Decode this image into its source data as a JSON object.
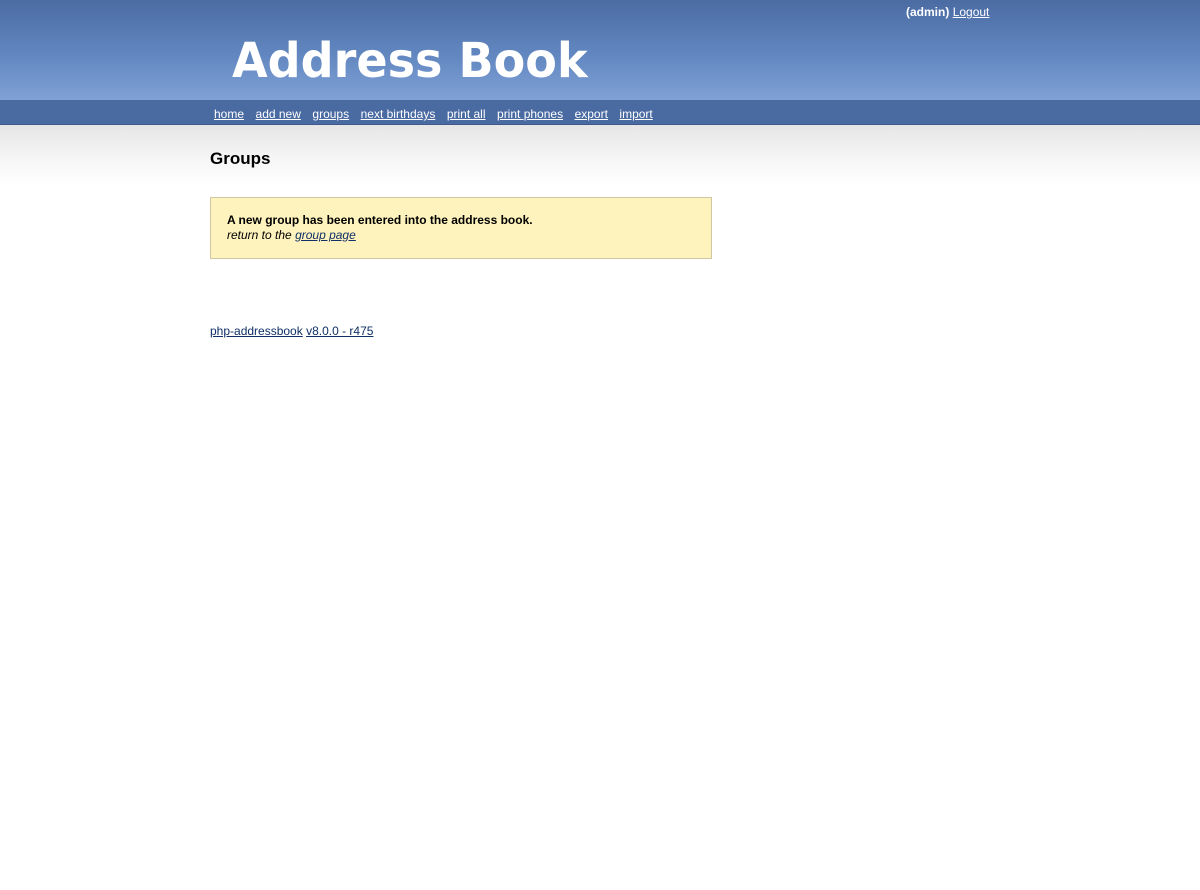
{
  "header": {
    "user_label": "(admin)",
    "logout_label": "Logout",
    "logo_text": "Address Book"
  },
  "nav": {
    "items": [
      {
        "label": "home"
      },
      {
        "label": "add new"
      },
      {
        "label": "groups"
      },
      {
        "label": "next birthdays"
      },
      {
        "label": "print all"
      },
      {
        "label": "print phones"
      },
      {
        "label": "export"
      },
      {
        "label": "import"
      }
    ]
  },
  "main": {
    "title": "Groups",
    "message": {
      "text": "A new group has been entered into the address book.",
      "return_prefix": "return to the",
      "return_link": "group page"
    }
  },
  "footer": {
    "product_link": "php-addressbook",
    "version_link": "v8.0.0 - r475"
  },
  "colors": {
    "header_top": "#4b6ba3",
    "header_bottom": "#7fa1d6",
    "nav_bg": "#4a6aa2",
    "message_bg": "#fef2bd",
    "link": "#0f2f66"
  }
}
